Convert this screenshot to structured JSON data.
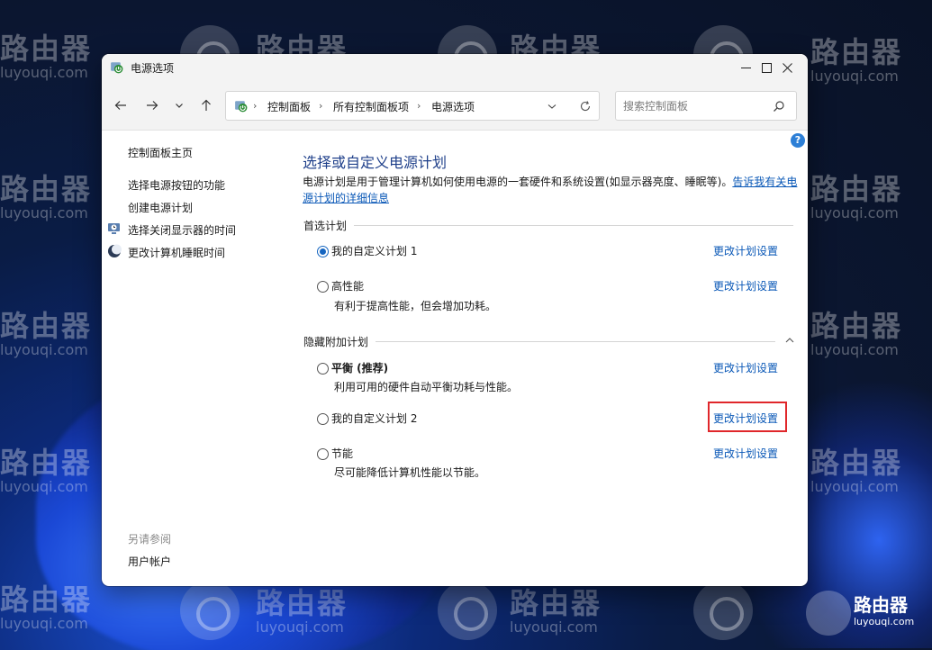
{
  "watermark": {
    "brand": "路由器",
    "domain": "luyouqi.com"
  },
  "corner_logo": {
    "brand": "路由器",
    "domain": "luyouqi.com"
  },
  "window": {
    "title": "电源选项",
    "icons": {
      "app": "power-options-icon",
      "minimize": "minimize-icon",
      "maximize": "maximize-icon",
      "close": "close-icon"
    }
  },
  "nav": {
    "breadcrumbs": [
      "控制面板",
      "所有控制面板项",
      "电源选项"
    ],
    "search_placeholder": "搜索控制面板",
    "icons": [
      "back-arrow-icon",
      "forward-arrow-icon",
      "recent-dropdown-icon",
      "up-arrow-icon",
      "refresh-icon",
      "search-icon"
    ]
  },
  "sidebar": {
    "home": "控制面板主页",
    "items": [
      {
        "label": "选择电源按钮的功能",
        "icon": ""
      },
      {
        "label": "创建电源计划",
        "icon": ""
      },
      {
        "label": "选择关闭显示器的时间",
        "icon": "monitor-clock-icon"
      },
      {
        "label": "更改计算机睡眠时间",
        "icon": "moon-icon"
      }
    ],
    "see_also_title": "另请参阅",
    "see_also_items": [
      "用户帐户"
    ]
  },
  "main": {
    "heading": "选择或自定义电源计划",
    "description": "电源计划是用于管理计算机如何使用电源的一套硬件和系统设置(如显示器亮度、睡眠等)。",
    "description_link": "告诉我有关电源计划的详细信息",
    "preferred_label": "首选计划",
    "hidden_label": "隐藏附加计划",
    "change_label": "更改计划设置",
    "plans_preferred": [
      {
        "name": "我的自定义计划 1",
        "desc": "",
        "selected": true
      },
      {
        "name": "高性能",
        "desc": "有利于提高性能，但会增加功耗。",
        "selected": false
      }
    ],
    "plans_hidden": [
      {
        "name": "平衡 (推荐)",
        "desc": "利用可用的硬件自动平衡功耗与性能。",
        "selected": false
      },
      {
        "name": "我的自定义计划 2",
        "desc": "",
        "selected": false
      },
      {
        "name": "节能",
        "desc": "尽可能降低计算机性能以节能。",
        "selected": false
      }
    ],
    "highlight_color": "#e0272b",
    "link_color": "#0a58b7"
  }
}
